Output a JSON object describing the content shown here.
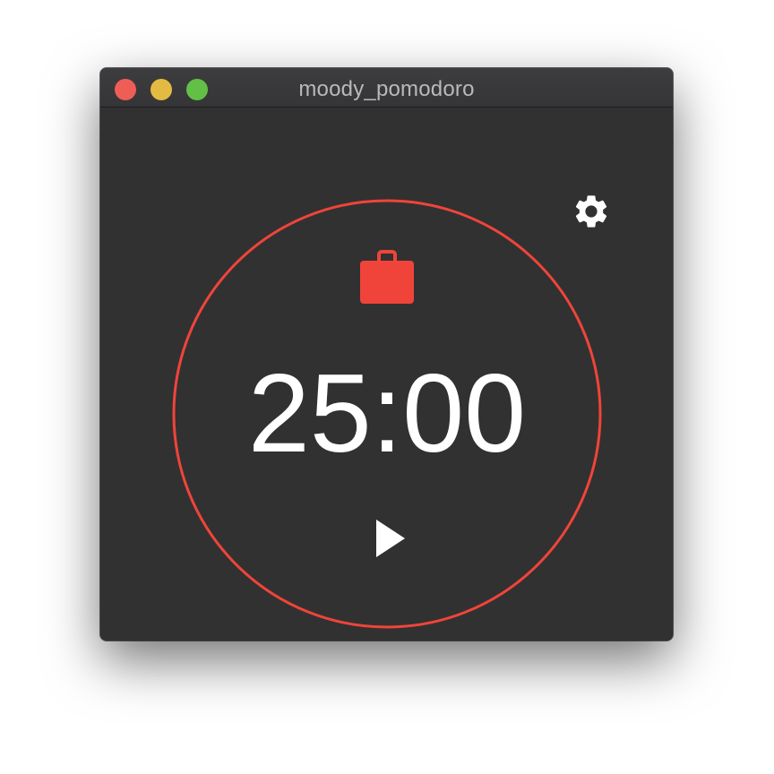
{
  "window": {
    "title": "moody_pomodoro"
  },
  "timer": {
    "display": "25:00"
  },
  "icons": {
    "settings": "gear-icon",
    "mode": "briefcase-icon",
    "play": "play-icon"
  },
  "colors": {
    "accent": "#f0443a",
    "background": "#313131",
    "text": "#ffffff",
    "close": "#ee5e56",
    "minimize": "#e3bb43",
    "maximize": "#63c046"
  }
}
